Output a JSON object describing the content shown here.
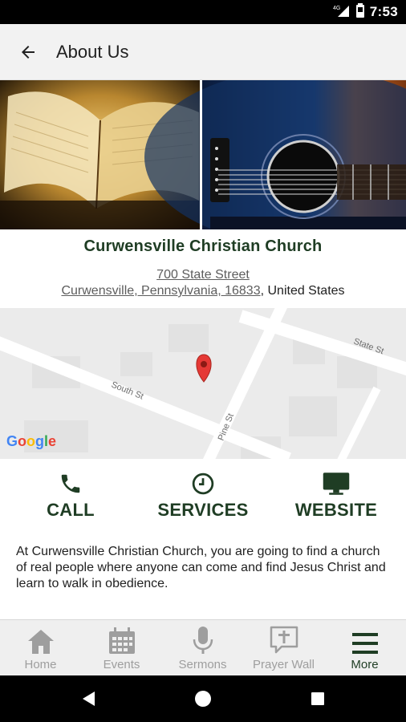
{
  "status_bar": {
    "time": "7:53",
    "network": "4G"
  },
  "app_bar": {
    "title": "About Us"
  },
  "church": {
    "name": "Curwensville Christian Church",
    "street": "700 State Street",
    "city_line": "Curwensville, Pennsylvania, 16833",
    "country": ", United States"
  },
  "map": {
    "streets": [
      "State St",
      "South St",
      "Pine St"
    ],
    "attribution": "Google"
  },
  "actions": [
    {
      "label": "CALL",
      "icon": "phone-icon"
    },
    {
      "label": "SERVICES",
      "icon": "clock-icon"
    },
    {
      "label": "WEBSITE",
      "icon": "monitor-icon"
    }
  ],
  "about_text": "At Curwensville Christian Church, you are going to find a church of real people where anyone can come and find Jesus Christ  and learn to walk in obedience.",
  "bottom_nav": [
    {
      "label": "Home",
      "icon": "home-icon",
      "active": false
    },
    {
      "label": "Events",
      "icon": "calendar-icon",
      "active": false
    },
    {
      "label": "Sermons",
      "icon": "microphone-icon",
      "active": false
    },
    {
      "label": "Prayer Wall",
      "icon": "prayer-bubble-icon",
      "active": false
    },
    {
      "label": "More",
      "icon": "menu-icon",
      "active": true
    }
  ],
  "colors": {
    "brand_green": "#1f3d24",
    "app_bar_bg": "#f2f2f2",
    "map_pin": "#e53935",
    "nav_inactive": "#9e9e9e"
  }
}
